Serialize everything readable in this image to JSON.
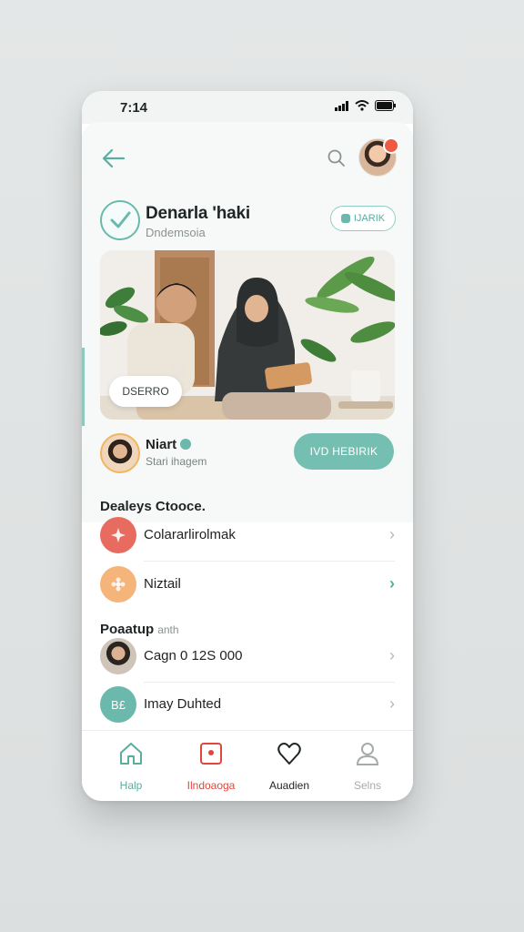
{
  "status": {
    "time": "7:14"
  },
  "header": {
    "back_icon": "arrow-left-icon",
    "search_icon": "search-icon",
    "avatar_badge_color": "#ef5a43"
  },
  "profile": {
    "name": "Denarla 'haki",
    "subtitle": "Dndemsoia",
    "follow_label": "IJARIK"
  },
  "hero": {
    "chip_label": "DSERRO"
  },
  "author": {
    "name": "Niart",
    "subtitle": "Stari ihagem",
    "cta_label": "IVD HEBIRIK"
  },
  "section1": {
    "title": "Dealeys Ctooce.",
    "items": [
      {
        "label": "Colararlirolmak",
        "icon": "sparkle-icon",
        "color": "#e86b5f"
      },
      {
        "label": "Niztail",
        "icon": "flower-icon",
        "color": "#f5b57a"
      }
    ]
  },
  "section2": {
    "title": "Poaatup",
    "title_suffix": "anth",
    "items": [
      {
        "label": "Cagn 0 12S 000",
        "icon": "person-photo"
      },
      {
        "label": "Imay Duhted",
        "icon": "badge-icon",
        "badge_text": "B£",
        "color": "#6bb9ac"
      }
    ]
  },
  "tabs": [
    {
      "label": "Halp",
      "icon": "home-icon",
      "color": "#5aaea0"
    },
    {
      "label": "Ilndoaoga",
      "icon": "bag-icon",
      "color": "#e0473b"
    },
    {
      "label": "Auadien",
      "icon": "heart-icon",
      "color": "#1f2424"
    },
    {
      "label": "Selns",
      "icon": "user-icon",
      "color": "#a5abab"
    }
  ],
  "colors": {
    "accent": "#74bfb2",
    "accent_dark": "#5aaea0"
  }
}
